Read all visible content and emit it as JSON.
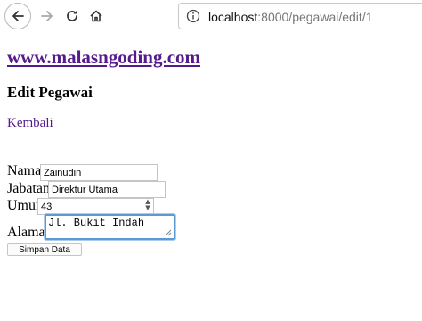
{
  "browser": {
    "url_host": "localhost",
    "url_path": ":8000/pegawai/edit/1"
  },
  "page": {
    "site_link": "www.malasngoding.com",
    "title": "Edit Pegawai",
    "back_link": "Kembali"
  },
  "form": {
    "nama_label": "Nama",
    "nama_value": "Zainudin",
    "jabatan_label": "Jabatan",
    "jabatan_value": "Direktur Utama",
    "umur_label": "Umur",
    "umur_value": "43",
    "alamat_label": "Alamat",
    "alamat_value": "Jl. Bukit Indah",
    "submit_label": "Simpan Data"
  },
  "colors": {
    "link": "#551A8B",
    "focus": "#5b9bd5"
  }
}
